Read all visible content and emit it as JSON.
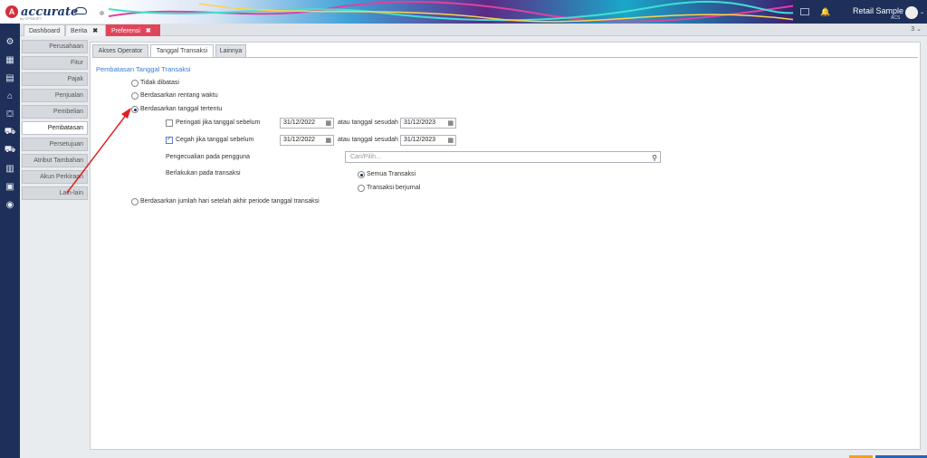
{
  "brand": {
    "logo_letter": "A",
    "name": "accurate",
    "sub": "by CPSSOFT",
    "online_label": "online"
  },
  "user": {
    "store": "Retail Sample",
    "code": "ACS"
  },
  "colors": {
    "navy": "#1e2f5a",
    "active_tab": "#e0465a",
    "accent_blue": "#3a7bd5",
    "arrow": "#e02020"
  },
  "page_tabs": [
    {
      "label": "Dashboard"
    },
    {
      "label": "Berita",
      "close": "✖"
    },
    {
      "label": "Preferensi",
      "close": "✖"
    }
  ],
  "tab_count": "3 ⌄",
  "left_menu": [
    "Perusahaan",
    "Fitur",
    "Pajak",
    "Penjualan",
    "Pembelian",
    "Pembatasan",
    "Persetujuan",
    "Atribut Tambahan",
    "Akun Perkiraan",
    "Lain-lain"
  ],
  "sub_tabs": [
    "Akses Operator",
    "Tanggal Transaksi",
    "Lainnya"
  ],
  "section_title": "Pembatasan Tanggal Transaksi",
  "options": {
    "tidak_dibatasi": "Tidak dibatasi",
    "rentang_waktu": "Berdasarkan rentang waktu",
    "tanggal_tertentu": "Berdasarkan tanggal tertentu",
    "jumlah_hari": "Berdasarkan jumlah hari setelah akhir periode tanggal transaksi"
  },
  "warn": {
    "label": "Peringati jika tanggal sebelum",
    "before": "31/12/2022",
    "after_label": "atau tanggal sesudah",
    "after": "31/12/2023",
    "checked": false
  },
  "block": {
    "label": "Cegah jika tanggal sebelum",
    "before": "31/12/2022",
    "after_label": "atau tanggal sesudah",
    "after": "31/12/2023",
    "checked": true
  },
  "exception": {
    "label": "Pengecualian pada pengguna",
    "placeholder": "Cari/Pilih..."
  },
  "applies": {
    "label": "Berlakukan pada transaksi",
    "all": "Semua Transaksi",
    "journaled": "Transaksi berjurnal"
  },
  "icons": {
    "settings": "gear-icon",
    "company": "building-icon",
    "ledger": "book-icon",
    "bank": "bank-icon",
    "cart": "cart-icon",
    "search": "search-icon",
    "calendar": "calendar-icon"
  }
}
